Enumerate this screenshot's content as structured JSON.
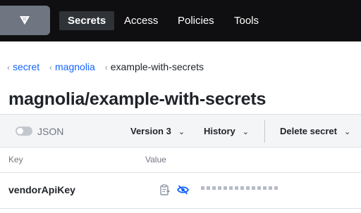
{
  "nav": {
    "logo_icon": "vault-logo-icon",
    "items": [
      {
        "label": "Secrets",
        "active": true
      },
      {
        "label": "Access",
        "active": false
      },
      {
        "label": "Policies",
        "active": false
      },
      {
        "label": "Tools",
        "active": false
      }
    ]
  },
  "breadcrumb": {
    "items": [
      {
        "label": "secret",
        "link": true
      },
      {
        "label": "magnolia",
        "link": true
      },
      {
        "label": "example-with-secrets",
        "link": false
      }
    ]
  },
  "page_title": "magnolia/example-with-secrets",
  "toolbar": {
    "json_label": "JSON",
    "json_enabled": false,
    "version_label": "Version 3",
    "history_label": "History",
    "delete_label": "Delete secret"
  },
  "table": {
    "columns": [
      "Key",
      "Value"
    ],
    "rows": [
      {
        "key": "vendorApiKey",
        "value_masked": true,
        "masked_length": 14
      }
    ]
  },
  "colors": {
    "nav_bg": "#0f0f11",
    "link": "#1563ff",
    "icon_blue": "#1563ff"
  }
}
